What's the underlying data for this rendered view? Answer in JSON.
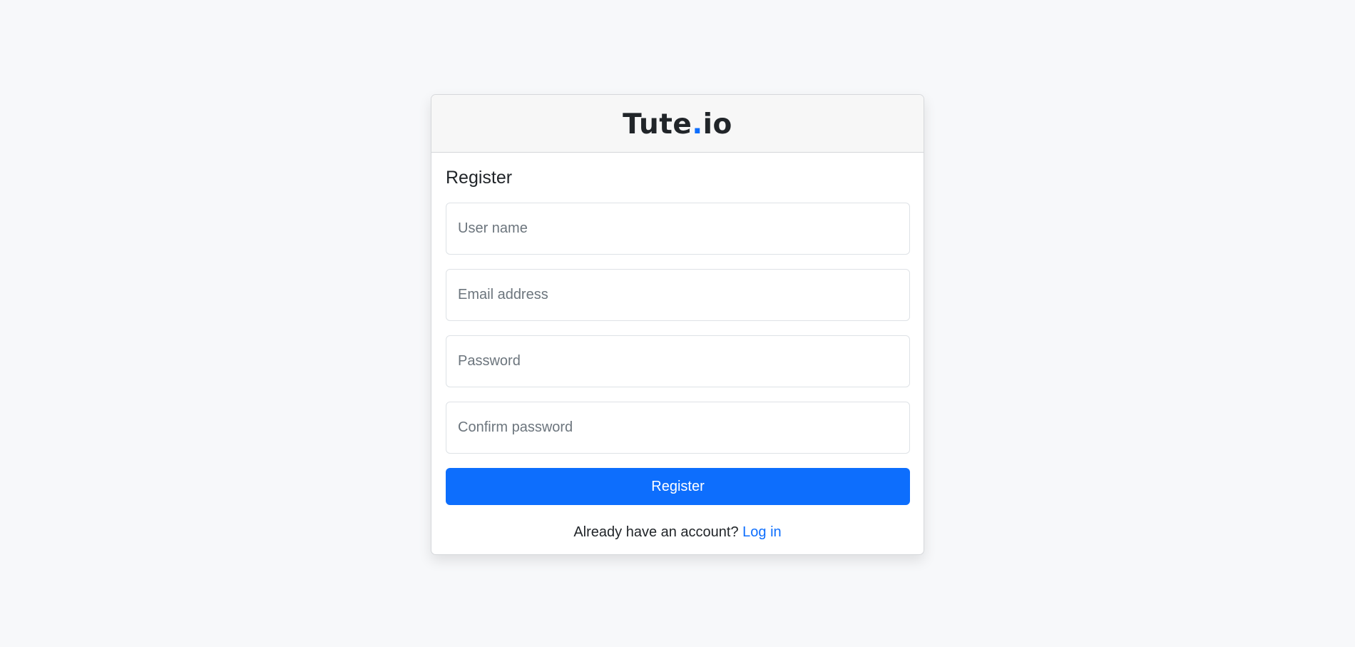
{
  "brand": {
    "name_part1": "Tute",
    "dot": ".",
    "name_part2": "io",
    "accent_color": "#0d6efd"
  },
  "form": {
    "title": "Register",
    "fields": {
      "username": {
        "placeholder": "User name",
        "value": ""
      },
      "email": {
        "placeholder": "Email address",
        "value": ""
      },
      "password": {
        "placeholder": "Password",
        "value": ""
      },
      "confirm_password": {
        "placeholder": "Confirm password",
        "value": ""
      }
    },
    "submit_label": "Register"
  },
  "footer": {
    "prompt": "Already have an account?",
    "login_link": "Log in"
  }
}
